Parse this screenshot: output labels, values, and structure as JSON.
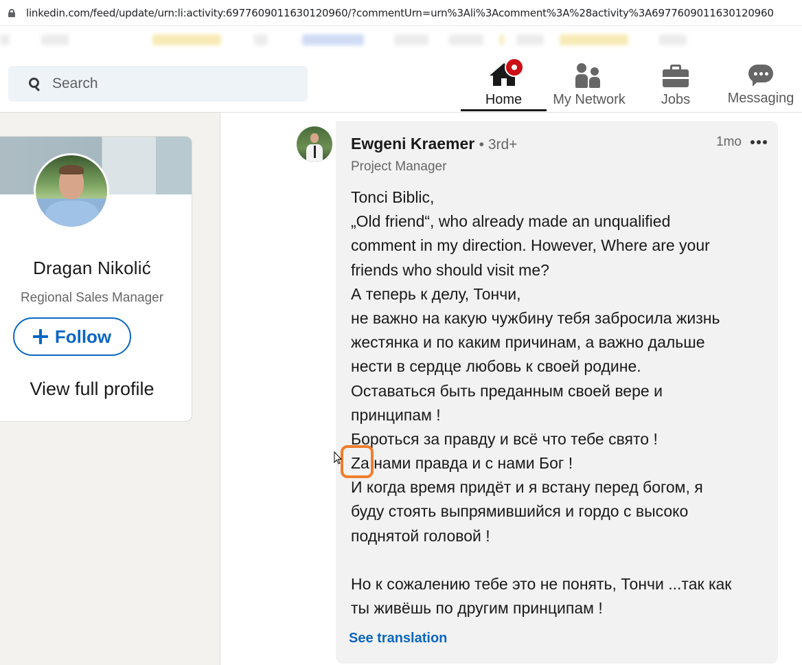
{
  "browser": {
    "url": "linkedin.com/feed/update/urn:li:activity:6977609011630120960/?commentUrn=urn%3Ali%3Acomment%3A%28activity%3A6977609011630120960"
  },
  "header": {
    "search_placeholder": "Search",
    "nav": [
      {
        "label": "Home",
        "icon": "home-icon",
        "active": true
      },
      {
        "label": "My Network",
        "icon": "network-icon"
      },
      {
        "label": "Jobs",
        "icon": "jobs-icon"
      },
      {
        "label": "Messaging",
        "icon": "messaging-icon"
      }
    ]
  },
  "profile_card": {
    "name": "Dragan Nikolić",
    "title": "Regional Sales Manager",
    "follow_label": "Follow",
    "view_profile_label": "View full profile"
  },
  "comment": {
    "author": "Ewgeni Kraemer",
    "degree": "• 3rd+",
    "headline": "Project Manager",
    "time": "1mo",
    "lines": [
      "Tonci Biblic,",
      "„Old friend“, who already made an unqualified",
      "comment in my direction. However, Where are your",
      "friends who should visit me?",
      "А теперь к делу, Тончи,",
      "не важно на какую чужбину тебя забросила жизнь",
      "жестянка и по каким причинам, а важно дальше",
      "нести в сердце любовь к своей родине.",
      "Оставаться быть преданным своей вере и",
      "принципам !",
      "Бороться за правду и всё что тебе свято !",
      "Za нами правда и с нами Бог !",
      "И когда время придёт и я встану перед богом, я",
      "буду стоять выпрямившийся и гордо с высоко",
      "поднятой головой !",
      "",
      "Но к сожалению тебе это не понять, Тончи ...так как",
      "ты живёшь по другим принципам !"
    ],
    "see_translation": "See translation"
  },
  "colors": {
    "accent": "#0a66c2",
    "highlight": "#f07d2c",
    "notification": "#cc1016"
  }
}
